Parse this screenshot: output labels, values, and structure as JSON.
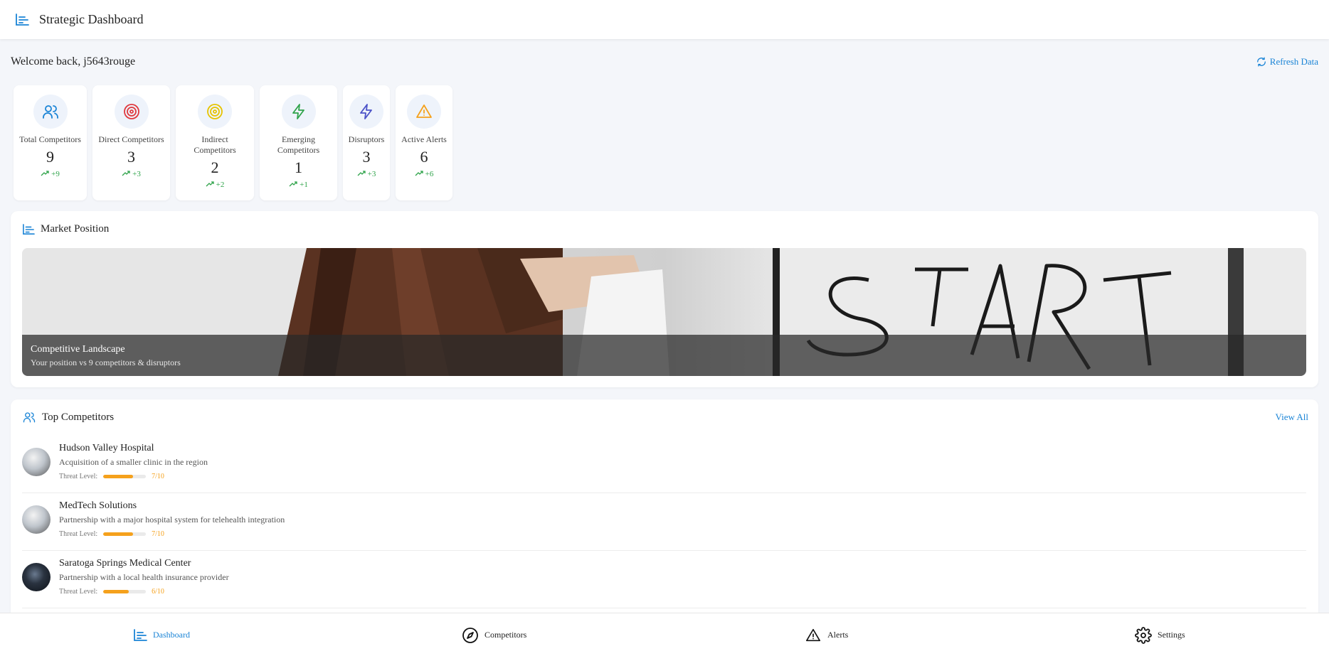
{
  "header": {
    "title": "Strategic Dashboard",
    "icon": "bar-chart-icon"
  },
  "welcome": {
    "text": "Welcome back, j5643rouge"
  },
  "refresh": {
    "label": "Refresh Data",
    "icon": "refresh-icon"
  },
  "colors": {
    "accent": "#1a84d6",
    "positive": "#2fa34a",
    "warning": "#f5a11c"
  },
  "stats": [
    {
      "label": "Total Competitors",
      "value": "9",
      "delta": "+9",
      "icon": "users-icon",
      "icon_color": "#1a84d6"
    },
    {
      "label": "Direct Competitors",
      "value": "3",
      "delta": "+3",
      "icon": "target-icon",
      "icon_color": "#e0393e"
    },
    {
      "label": "Indirect Competitors",
      "value": "2",
      "delta": "+2",
      "icon": "target-icon",
      "icon_color": "#e6c300"
    },
    {
      "label": "Emerging Competitors",
      "value": "1",
      "delta": "+1",
      "icon": "lightning-icon",
      "icon_color": "#2fa34a"
    },
    {
      "label": "Disruptors",
      "value": "3",
      "delta": "+3",
      "icon": "lightning-icon",
      "icon_color": "#4b52c8"
    },
    {
      "label": "Active Alerts",
      "value": "6",
      "delta": "+6",
      "icon": "alert-triangle-icon",
      "icon_color": "#f5a11c"
    }
  ],
  "market": {
    "title": "Market Position",
    "hero_title": "Competitive Landscape",
    "hero_subtitle": "Your position vs 9 competitors & disruptors"
  },
  "competitors": {
    "title": "Top Competitors",
    "view_all": "View All",
    "threat_label": "Threat Level:",
    "items": [
      {
        "name": "Hudson Valley Hospital",
        "description": "Acquisition of a smaller clinic in the region",
        "threat": 7,
        "threat_text": "7/10"
      },
      {
        "name": "MedTech Solutions",
        "description": "Partnership with a major hospital system for telehealth integration",
        "threat": 7,
        "threat_text": "7/10"
      },
      {
        "name": "Saratoga Springs Medical Center",
        "description": "Partnership with a local health insurance provider",
        "threat": 6,
        "threat_text": "6/10"
      }
    ]
  },
  "nav": [
    {
      "label": "Dashboard",
      "icon": "bar-chart-icon",
      "active": true
    },
    {
      "label": "Competitors",
      "icon": "compass-icon",
      "active": false
    },
    {
      "label": "Alerts",
      "icon": "alert-triangle-icon",
      "active": false
    },
    {
      "label": "Settings",
      "icon": "gear-icon",
      "active": false
    }
  ]
}
